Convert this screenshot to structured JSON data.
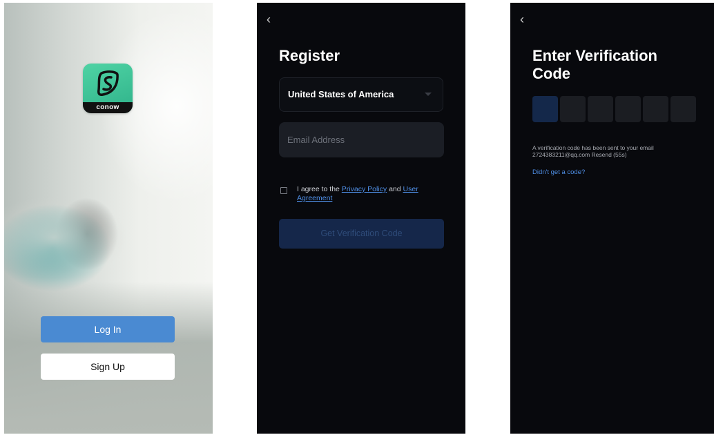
{
  "welcome": {
    "logo_text": "conow",
    "login_label": "Log In",
    "signup_label": "Sign Up"
  },
  "register": {
    "back_icon": "chevron-left-icon",
    "title": "Register",
    "country": "United States of America",
    "email_placeholder": "Email Address",
    "agree_prefix": "I agree to the ",
    "privacy_policy": "Privacy Policy",
    "and": " and ",
    "user_agreement": "User Agreement",
    "get_code_label": "Get Verification Code"
  },
  "verify": {
    "back_icon": "chevron-left-icon",
    "title_line1": "Enter Verification",
    "title_line2": "Code",
    "code_length": 6,
    "message_line1": "A verification code has been sent to your email",
    "message_line2": "2724383211@qq.com Resend (55s)",
    "no_code_link": "Didn't get a code?"
  },
  "colors": {
    "accent": "#4a8ad2",
    "app_green": "#35c194",
    "dark_bg": "#08090d",
    "link": "#4f8fe6"
  }
}
